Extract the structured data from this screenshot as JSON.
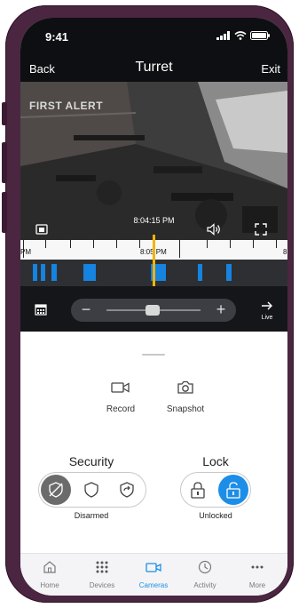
{
  "status_bar": {
    "time": "9:41"
  },
  "nav": {
    "back_label": "Back",
    "title": "Turret",
    "exit_label": "Exit"
  },
  "feed": {
    "brand_overlay": "FIRST ALERT",
    "timestamp": "8:04:15 PM"
  },
  "timeline": {
    "left_label": "PM",
    "center_label": "8:05 PM",
    "right_label": "8",
    "events_color": "#1683e0",
    "playhead_color": "#f2b400"
  },
  "controls": {
    "zoom_out": "−",
    "zoom_in": "+",
    "live_label": "Live"
  },
  "actions": [
    {
      "label": "Record",
      "icon": "video-camera-icon"
    },
    {
      "label": "Snapshot",
      "icon": "camera-icon"
    }
  ],
  "security": {
    "title": "Security",
    "state": "Disarmed",
    "options": [
      "disarmed-icon",
      "shield-icon",
      "arm-away-icon"
    ],
    "selected": 0,
    "selected_color": "#6b6b6b"
  },
  "lock": {
    "title": "Lock",
    "state": "Unlocked",
    "options": [
      "locked-icon",
      "unlocked-icon"
    ],
    "selected": 1,
    "selected_color": "#1c8ee8"
  },
  "tabs": [
    {
      "label": "Home",
      "icon": "home-icon",
      "active": false
    },
    {
      "label": "Devices",
      "icon": "devices-grid-icon",
      "active": false
    },
    {
      "label": "Cameras",
      "icon": "camera-icon",
      "active": true
    },
    {
      "label": "Activity",
      "icon": "clock-icon",
      "active": false
    },
    {
      "label": "More",
      "icon": "more-icon",
      "active": false
    }
  ],
  "colors": {
    "accent": "#1c8ee8",
    "frame": "#4a2640"
  }
}
